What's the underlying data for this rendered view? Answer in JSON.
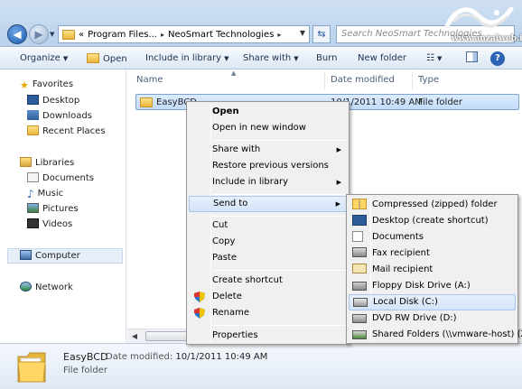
{
  "address": {
    "crumbs": [
      "«",
      "Program Files...",
      "▸",
      "NeoSmart Technologies",
      "▸"
    ],
    "search_placeholder": "Search NeoSmart Technologies"
  },
  "watermark": {
    "text": "www.anzalweb.ir"
  },
  "toolbar": {
    "organize": "Organize",
    "open": "Open",
    "include_in_library": "Include in library",
    "share_with": "Share with",
    "burn": "Burn",
    "new_folder": "New folder",
    "help": "?"
  },
  "nav": {
    "favorites": "Favorites",
    "desktop": "Desktop",
    "downloads": "Downloads",
    "recent_places": "Recent Places",
    "libraries": "Libraries",
    "documents": "Documents",
    "music": "Music",
    "pictures": "Pictures",
    "videos": "Videos",
    "computer": "Computer",
    "network": "Network"
  },
  "columns": {
    "name": "Name",
    "date_modified": "Date modified",
    "type": "Type"
  },
  "file": {
    "name": "EasyBCD",
    "date": "10/1/2011 10:49 AM",
    "type": "File folder"
  },
  "details": {
    "name": "EasyBCD",
    "modified_label": "Date modified:",
    "modified_value": "10/1/2011 10:49 AM",
    "type": "File folder"
  },
  "context_menu": {
    "open": "Open",
    "open_new_window": "Open in new window",
    "share_with": "Share with",
    "restore_previous": "Restore previous versions",
    "include_in_library": "Include in library",
    "send_to": "Send to",
    "cut": "Cut",
    "copy": "Copy",
    "paste": "Paste",
    "create_shortcut": "Create shortcut",
    "delete": "Delete",
    "rename": "Rename",
    "properties": "Properties"
  },
  "send_to_menu": {
    "compressed": "Compressed (zipped) folder",
    "desktop_shortcut": "Desktop (create shortcut)",
    "documents": "Documents",
    "fax": "Fax recipient",
    "mail": "Mail recipient",
    "floppy": "Floppy Disk Drive (A:)",
    "local_disk": "Local Disk (C:)",
    "dvd": "DVD RW Drive (D:)",
    "shared": "Shared Folders (\\\\vmware-host) (Z:)"
  }
}
